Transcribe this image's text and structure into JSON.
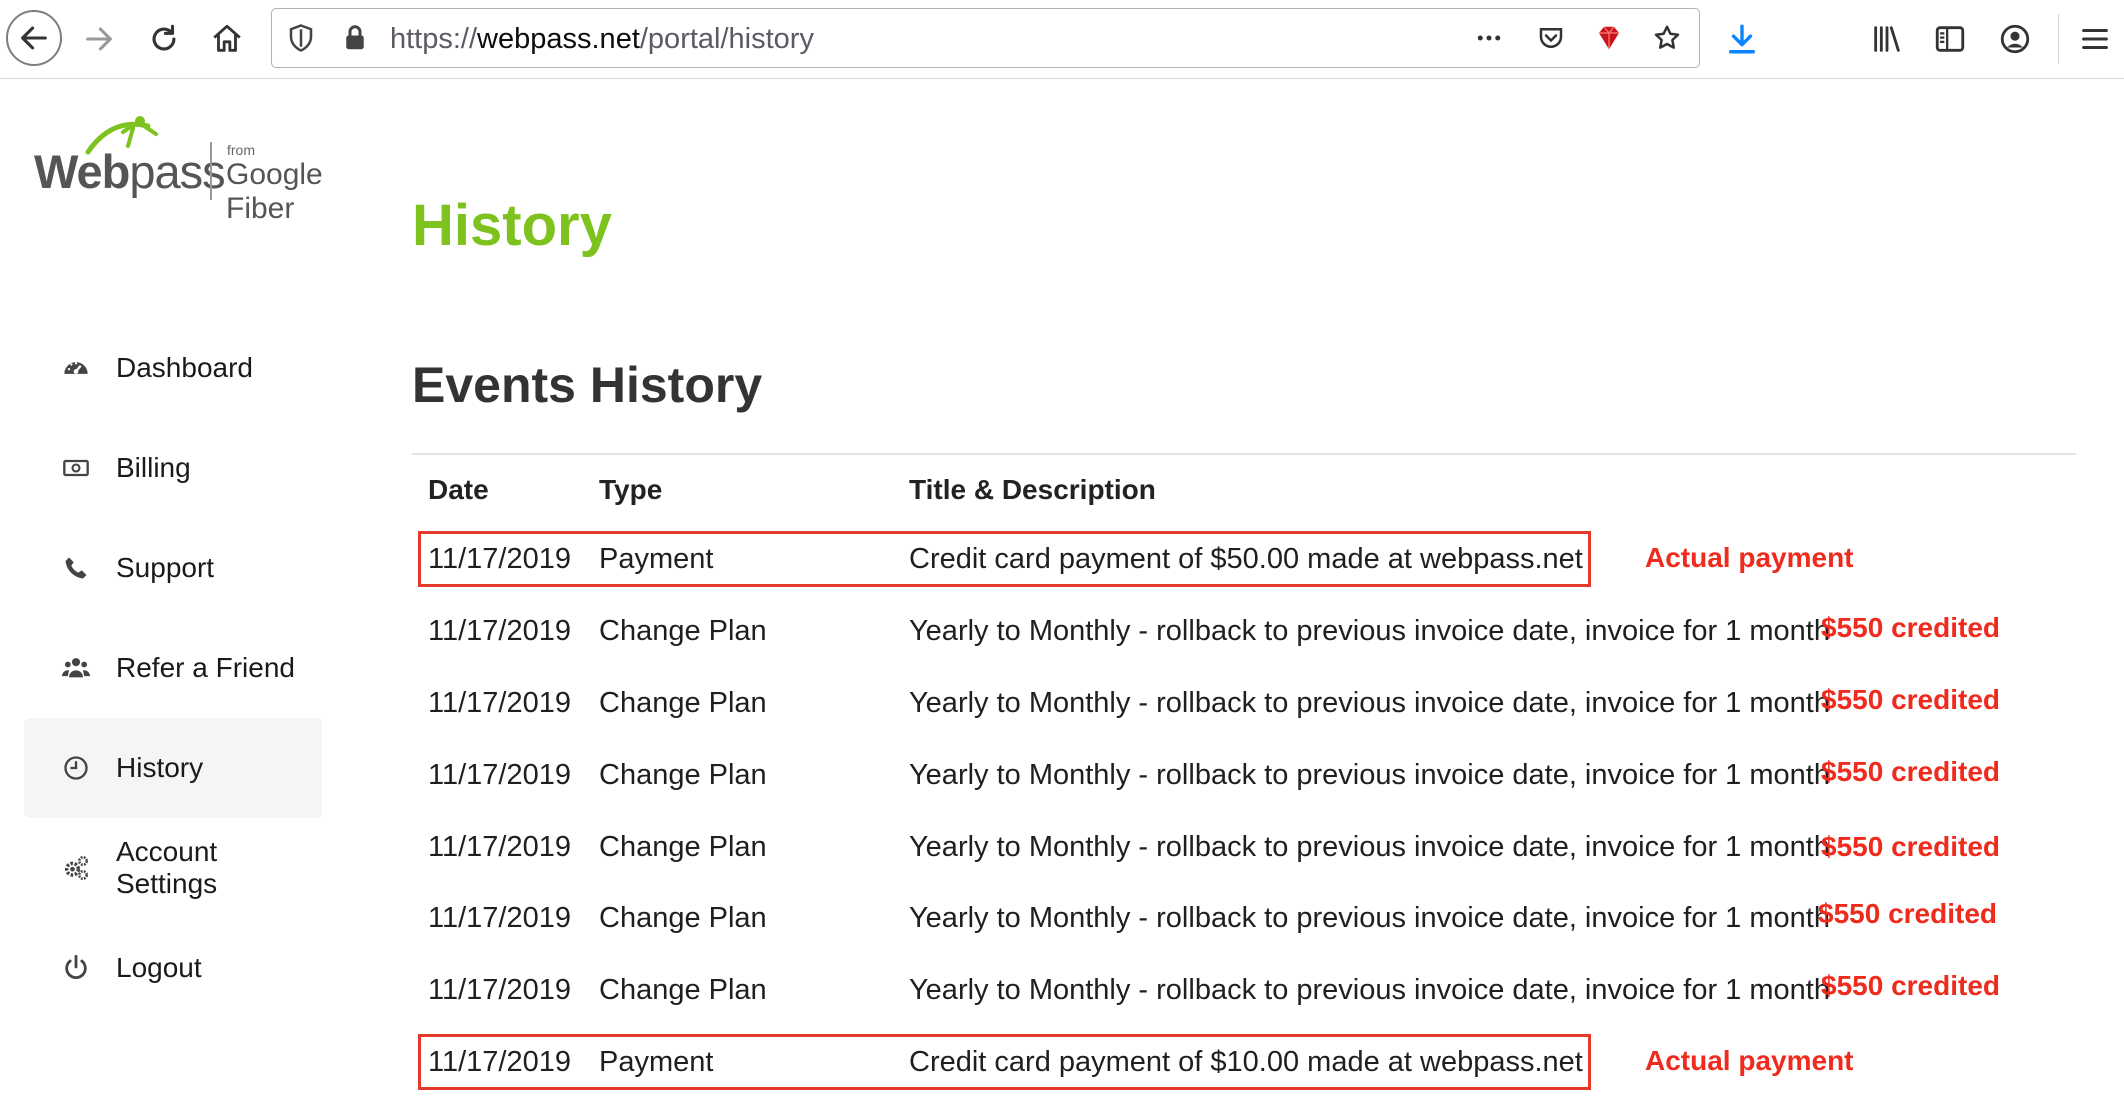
{
  "browser": {
    "url_prefix": "https://",
    "url_domain": "webpass.net",
    "url_path": "/portal/history",
    "icons": [
      "back-icon",
      "forward-icon",
      "reload-icon",
      "home-icon",
      "shield-icon",
      "lock-icon",
      "more-icon",
      "pocket-icon",
      "ruby-extension-icon",
      "bookmark-star-icon",
      "download-icon",
      "library-icon",
      "sidebar-icon",
      "account-icon",
      "menu-icon"
    ],
    "accent_color": "#0a84ff"
  },
  "logo": {
    "brand_bold": "Web",
    "brand_light": "pass",
    "from": "from",
    "partner": "Google Fiber",
    "brand_color": "#7dc21e"
  },
  "sidebar": {
    "items": [
      {
        "label": "Dashboard",
        "icon": "dashboard-icon",
        "active": false
      },
      {
        "label": "Billing",
        "icon": "billing-icon",
        "active": false
      },
      {
        "label": "Support",
        "icon": "phone-icon",
        "active": false
      },
      {
        "label": "Refer a Friend",
        "icon": "users-icon",
        "active": false
      },
      {
        "label": "History",
        "icon": "clock-icon",
        "active": true
      },
      {
        "label": "Account Settings",
        "icon": "gears-icon",
        "active": false
      },
      {
        "label": "Logout",
        "icon": "power-icon",
        "active": false
      }
    ]
  },
  "main": {
    "page_title": "History",
    "section_title": "Events History",
    "columns": [
      "Date",
      "Type",
      "Title & Description"
    ],
    "rows": [
      {
        "date": "11/17/2019",
        "type": "Payment",
        "description": "Credit card payment of $50.00 made at webpass.net",
        "annotation": "Actual payment",
        "highlighted": true
      },
      {
        "date": "11/17/2019",
        "type": "Change Plan",
        "description": "Yearly to Monthly - rollback to previous invoice date, invoice for 1 month",
        "annotation": "$550 credited",
        "highlighted": false
      },
      {
        "date": "11/17/2019",
        "type": "Change Plan",
        "description": "Yearly to Monthly - rollback to previous invoice date, invoice for 1 month",
        "annotation": "$550 credited",
        "highlighted": false
      },
      {
        "date": "11/17/2019",
        "type": "Change Plan",
        "description": "Yearly to Monthly - rollback to previous invoice date, invoice for 1 month",
        "annotation": "$550 credited",
        "highlighted": false
      },
      {
        "date": "11/17/2019",
        "type": "Change Plan",
        "description": "Yearly to Monthly - rollback to previous invoice date, invoice for 1 month",
        "annotation": "$550 credited",
        "highlighted": false
      },
      {
        "date": "11/17/2019",
        "type": "Change Plan",
        "description": "Yearly to Monthly - rollback to previous invoice date, invoice for 1 month",
        "annotation": "$550 credited",
        "highlighted": false
      },
      {
        "date": "11/17/2019",
        "type": "Change Plan",
        "description": "Yearly to Monthly - rollback to previous invoice date, invoice for 1 month",
        "annotation": "$550 credited",
        "highlighted": false
      },
      {
        "date": "11/17/2019",
        "type": "Payment",
        "description": "Credit card payment of $10.00 made at webpass.net",
        "annotation": "Actual payment",
        "highlighted": true
      }
    ],
    "annotation_color": "#ef2b1e",
    "title_color": "#7dc21e"
  }
}
